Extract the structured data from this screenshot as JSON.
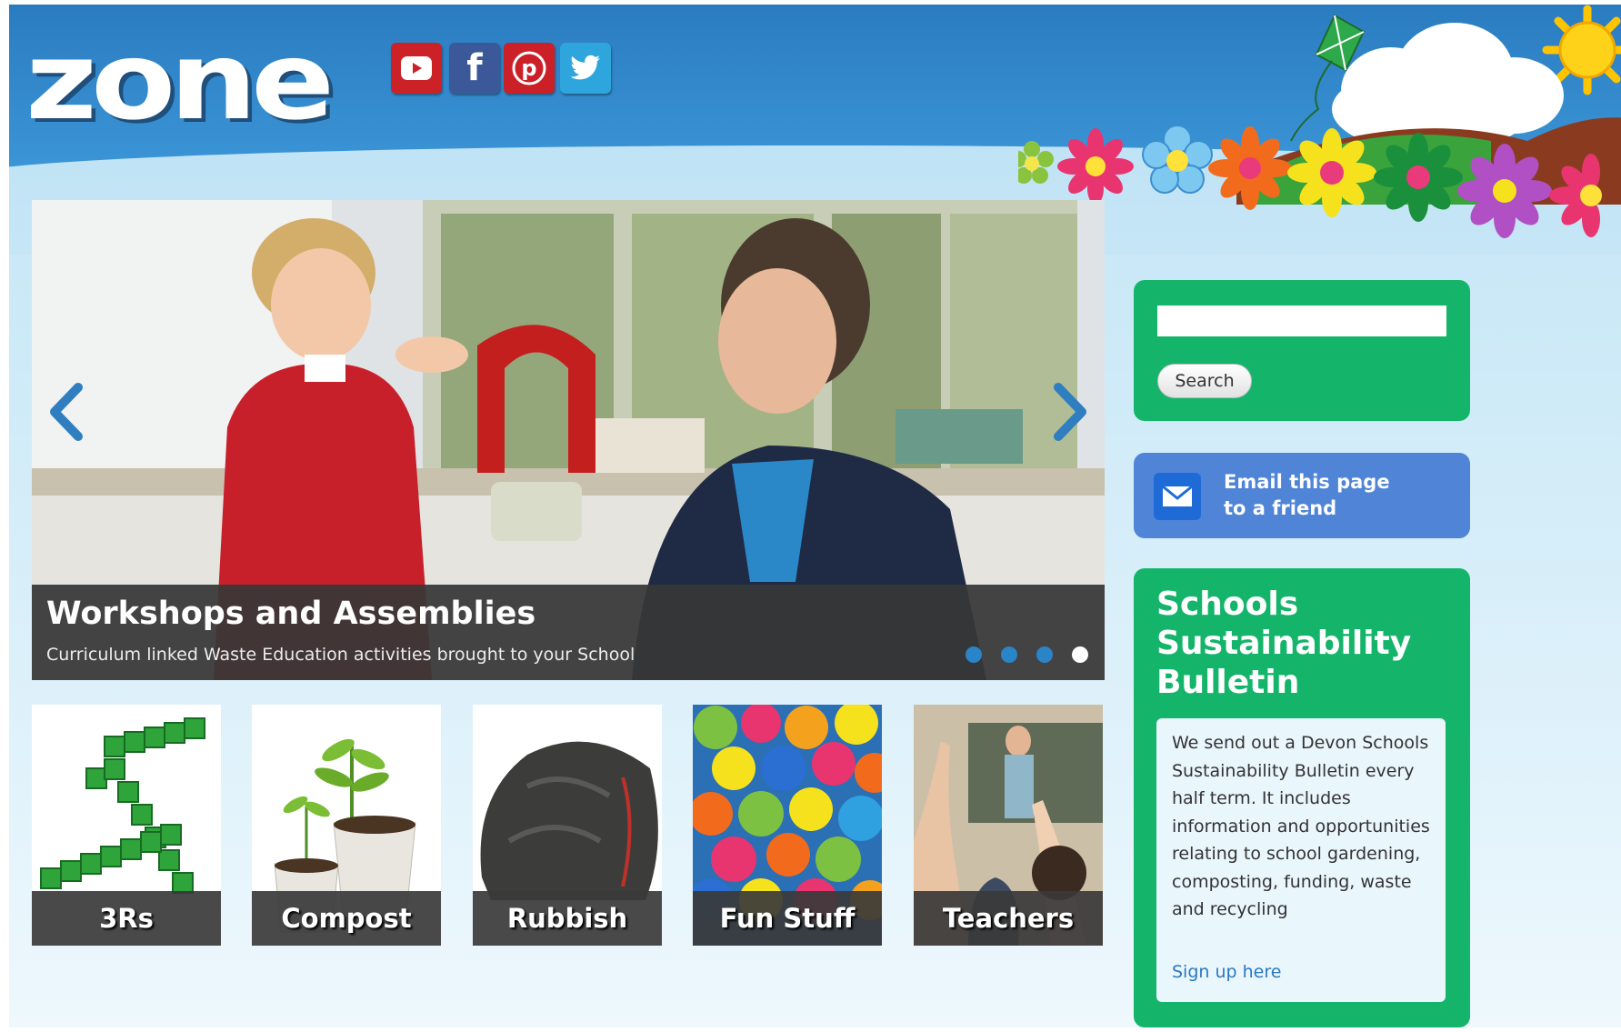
{
  "header": {
    "logo_text": "zone",
    "social": [
      {
        "name": "youtube",
        "icon": "youtube-icon",
        "color": "#cc2127"
      },
      {
        "name": "facebook",
        "icon": "facebook-icon",
        "color": "#3b5998"
      },
      {
        "name": "pinterest",
        "icon": "pinterest-icon",
        "color": "#cb2027"
      },
      {
        "name": "twitter",
        "icon": "twitter-icon",
        "color": "#2ea6dd"
      }
    ]
  },
  "slider": {
    "title": "Workshops and Assemblies",
    "subtitle": "Curriculum linked Waste Education activities brought to your School",
    "slide_count": 4,
    "active_slide": 4,
    "prev_icon": "chevron-left-icon",
    "next_icon": "chevron-right-icon"
  },
  "tiles": [
    {
      "label": "3Rs"
    },
    {
      "label": "Compost"
    },
    {
      "label": "Rubbish"
    },
    {
      "label": "Fun Stuff"
    },
    {
      "label": "Teachers"
    }
  ],
  "sidebar": {
    "search": {
      "value": "",
      "button_label": "Search"
    },
    "email": {
      "line1": "Email this page",
      "line2": "to a friend",
      "icon": "mail-icon"
    },
    "bulletin": {
      "title": "Schools Sustainability Bulletin",
      "text": "We send out a Devon Schools Sustainability Bulletin every half term. It includes information and opportunities relating to school gardening, composting, funding, waste and recycling",
      "link": "Sign up here"
    }
  },
  "colors": {
    "header_blue": "#2a7cc0",
    "panel_green": "#14b56a",
    "email_blue": "#4f84d6",
    "link_blue": "#2a78c2"
  }
}
